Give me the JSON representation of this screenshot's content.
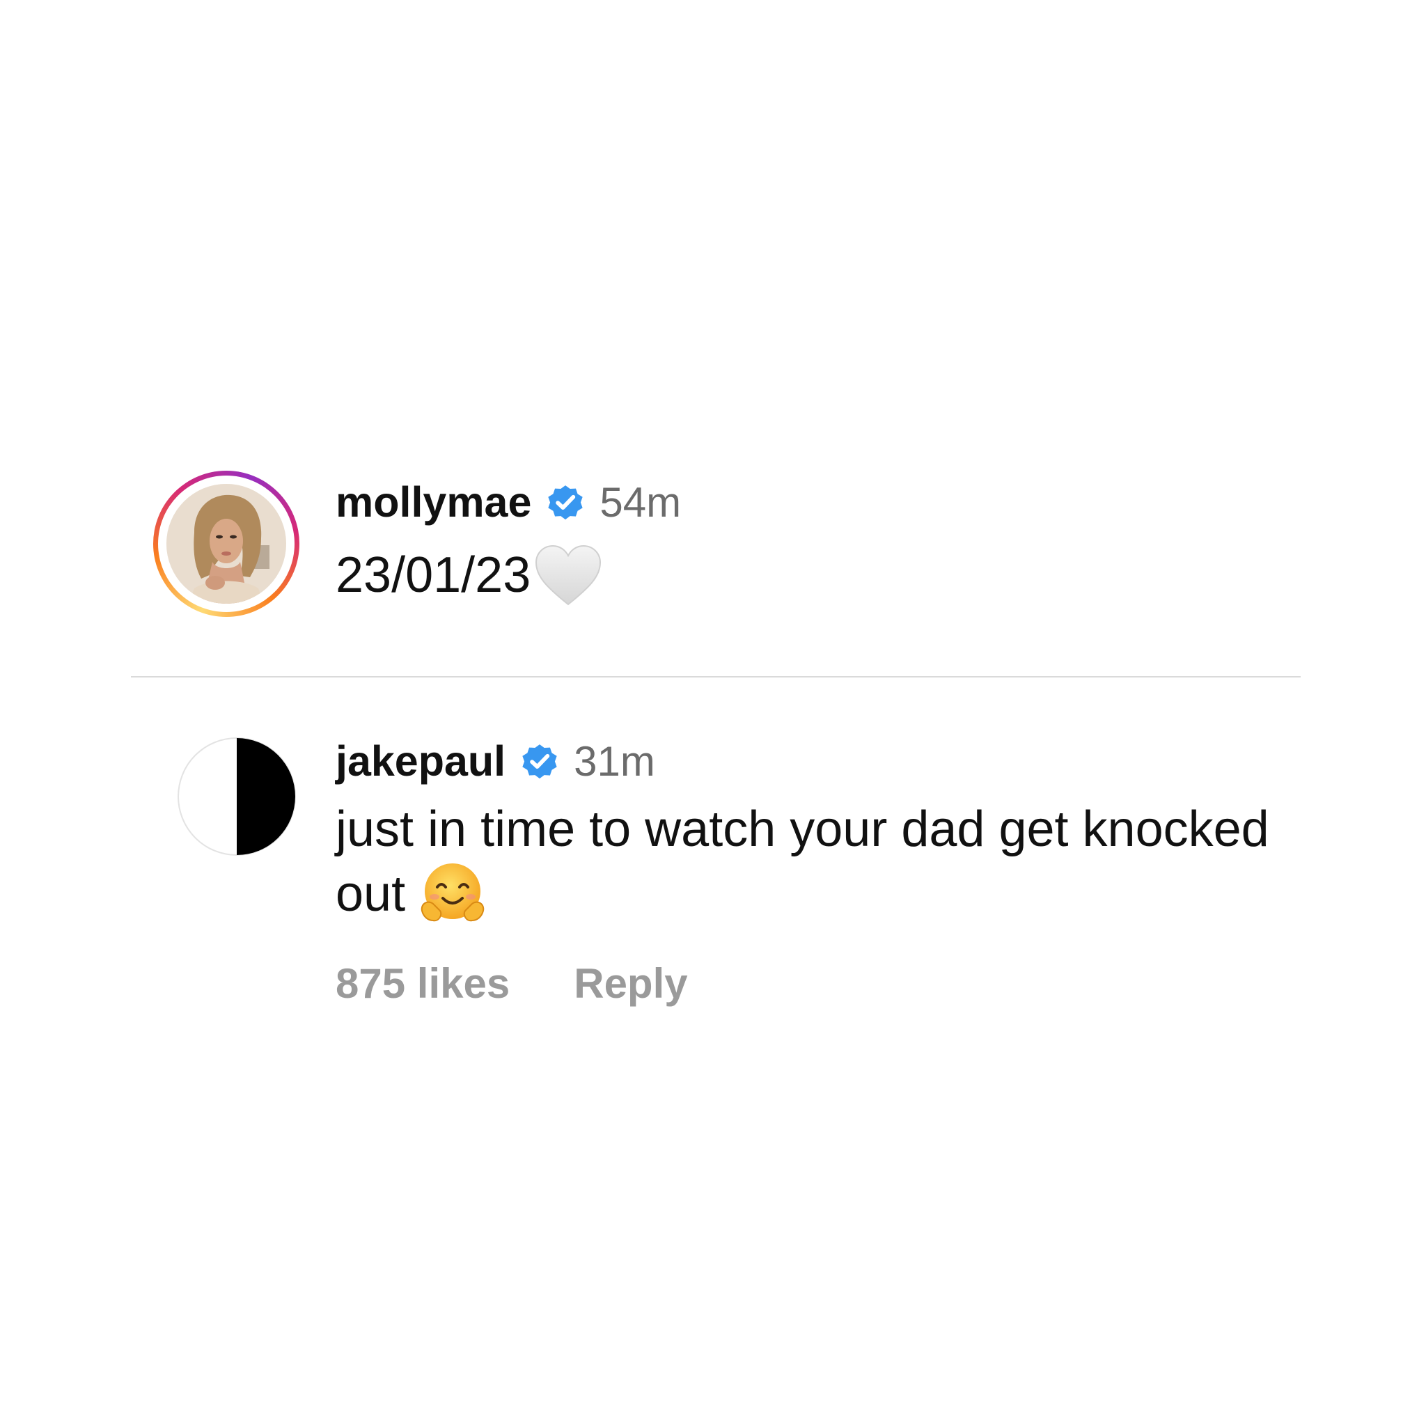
{
  "post": {
    "username": "mollymae",
    "verified": true,
    "time_ago": "54m",
    "text": "23/01/23",
    "emoji": "white-heart"
  },
  "comment": {
    "username": "jakepaul",
    "verified": true,
    "time_ago": "31m",
    "text": "just in time to watch your dad get knocked out",
    "emoji": "hugging-face",
    "likes": "875 likes",
    "reply_label": "Reply"
  },
  "colors": {
    "verified_blue": "#3897f0",
    "meta_gray": "#9a9a9a",
    "divider": "#dadada"
  }
}
